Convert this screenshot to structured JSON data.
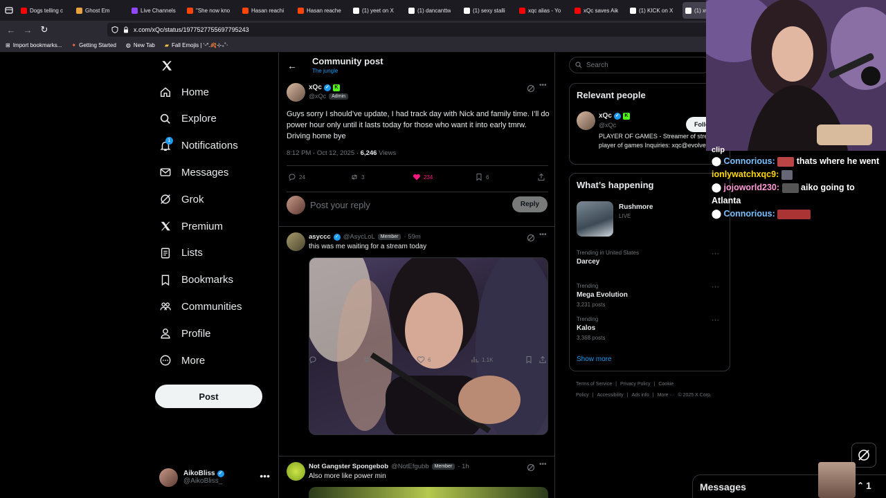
{
  "browser": {
    "tabs": [
      {
        "title": "Dogs telling c",
        "color": "#ff0000"
      },
      {
        "title": "Ghost Em",
        "color": "#e8a33d"
      },
      {
        "title": "Live Channels",
        "color": "#9146ff"
      },
      {
        "title": "\"She now kno",
        "color": "#ff4500"
      },
      {
        "title": "Hasan reachi",
        "color": "#ff4500"
      },
      {
        "title": "Hasan reache",
        "color": "#ff4500"
      },
      {
        "title": "(1) yeet on X",
        "color": "#ffffff"
      },
      {
        "title": "(1) dancanttw",
        "color": "#ffffff"
      },
      {
        "title": "(1) sexy stalli",
        "color": "#ffffff"
      },
      {
        "title": "xqc alias - Yo",
        "color": "#ff0000"
      },
      {
        "title": "xQc saves Aik",
        "color": "#ff0000"
      },
      {
        "title": "(1) KICK on X",
        "color": "#ffffff"
      },
      {
        "title": "(1) xQ",
        "color": "#ffffff"
      }
    ],
    "url": "x.com/xQc/status/1977527755697795243",
    "bookmarks": [
      "Import bookmarks...",
      "Getting Started",
      "New Tab",
      "Fall Emojis | ‘ᵕ˟.🍂⊹₊˚‧"
    ]
  },
  "nav": {
    "items": [
      {
        "label": "Home",
        "icon": "home-icon"
      },
      {
        "label": "Explore",
        "icon": "search-icon"
      },
      {
        "label": "Notifications",
        "icon": "bell-icon"
      },
      {
        "label": "Messages",
        "icon": "mail-icon"
      },
      {
        "label": "Grok",
        "icon": "grok-icon"
      },
      {
        "label": "Premium",
        "icon": "x-logo-icon"
      },
      {
        "label": "Lists",
        "icon": "list-icon"
      },
      {
        "label": "Bookmarks",
        "icon": "bookmark-icon"
      },
      {
        "label": "Communities",
        "icon": "people-icon"
      },
      {
        "label": "Profile",
        "icon": "person-icon"
      },
      {
        "label": "More",
        "icon": "more-circle-icon"
      }
    ],
    "notif_badge": "1",
    "post_label": "Post",
    "account": {
      "name": "AikoBliss",
      "handle": "@AikoBliss_"
    }
  },
  "header": {
    "title": "Community post",
    "subtitle": "The jungle"
  },
  "post": {
    "name": "xQc",
    "handle": "@xQc",
    "role": "Admin",
    "text": "Guys sorry I should’ve update, I had track day with Nick and family time. I’ll do power hour only until it lasts today for those who want it into early tmrw. Driving home bye",
    "time": "8:12 PM · Oct 12, 2025 ·",
    "views": "6,246",
    "views_label": "Views",
    "replies": "24",
    "reposts": "3",
    "likes": "234",
    "bookmarks": "6"
  },
  "reply_box": {
    "placeholder": "Post your reply",
    "button": "Reply"
  },
  "replies": [
    {
      "name": "asyccc",
      "handle": "@AsycLoL",
      "role": "Member",
      "time": "· 59m",
      "text": "this was me waiting for a stream today",
      "likes": "6",
      "views": "1.1K"
    },
    {
      "name": "Not Gangster Spongebob",
      "handle": "@NotEfgubb",
      "role": "Member",
      "time": "· 1h",
      "text": "Also more like power min"
    }
  ],
  "right": {
    "search_placeholder": "Search",
    "relevant_title": "Relevant people",
    "person": {
      "name": "xQc",
      "handle": "@xQc",
      "bio": "PLAYER OF GAMES - Streamer of streams, player of games Inquiries: xqc@evolved.gg",
      "follow": "Follo"
    },
    "happening_title": "What’s happening",
    "live": {
      "name": "Rushmore",
      "status": "LIVE"
    },
    "trends": [
      {
        "context": "Trending in United States",
        "name": "Darcey",
        "posts": ""
      },
      {
        "context": "Trending",
        "name": "Mega Evolution",
        "posts": "3,231 posts"
      },
      {
        "context": "Trending",
        "name": "Kalos",
        "posts": "3,368 posts"
      }
    ],
    "show_more": "Show more",
    "footer": [
      "Terms of Service",
      "|",
      "Privacy Policy",
      "|",
      "Cookie Policy",
      "|",
      "Accessibility",
      "|",
      "Ads info",
      "|",
      "More ···",
      "© 2025 X Corp."
    ]
  },
  "overlay": {
    "chat": [
      {
        "user": "",
        "text": "clip"
      },
      {
        "user": "Connorious:",
        "text": "thats where he went"
      },
      {
        "user": "ionlywatchxqc9:",
        "text": ""
      },
      {
        "user": "jojoworld230:",
        "text": "aiko going to Atlanta"
      },
      {
        "user": "Connorious:",
        "text": ""
      }
    ],
    "messages_label": "Messages",
    "messages_count": "1"
  }
}
